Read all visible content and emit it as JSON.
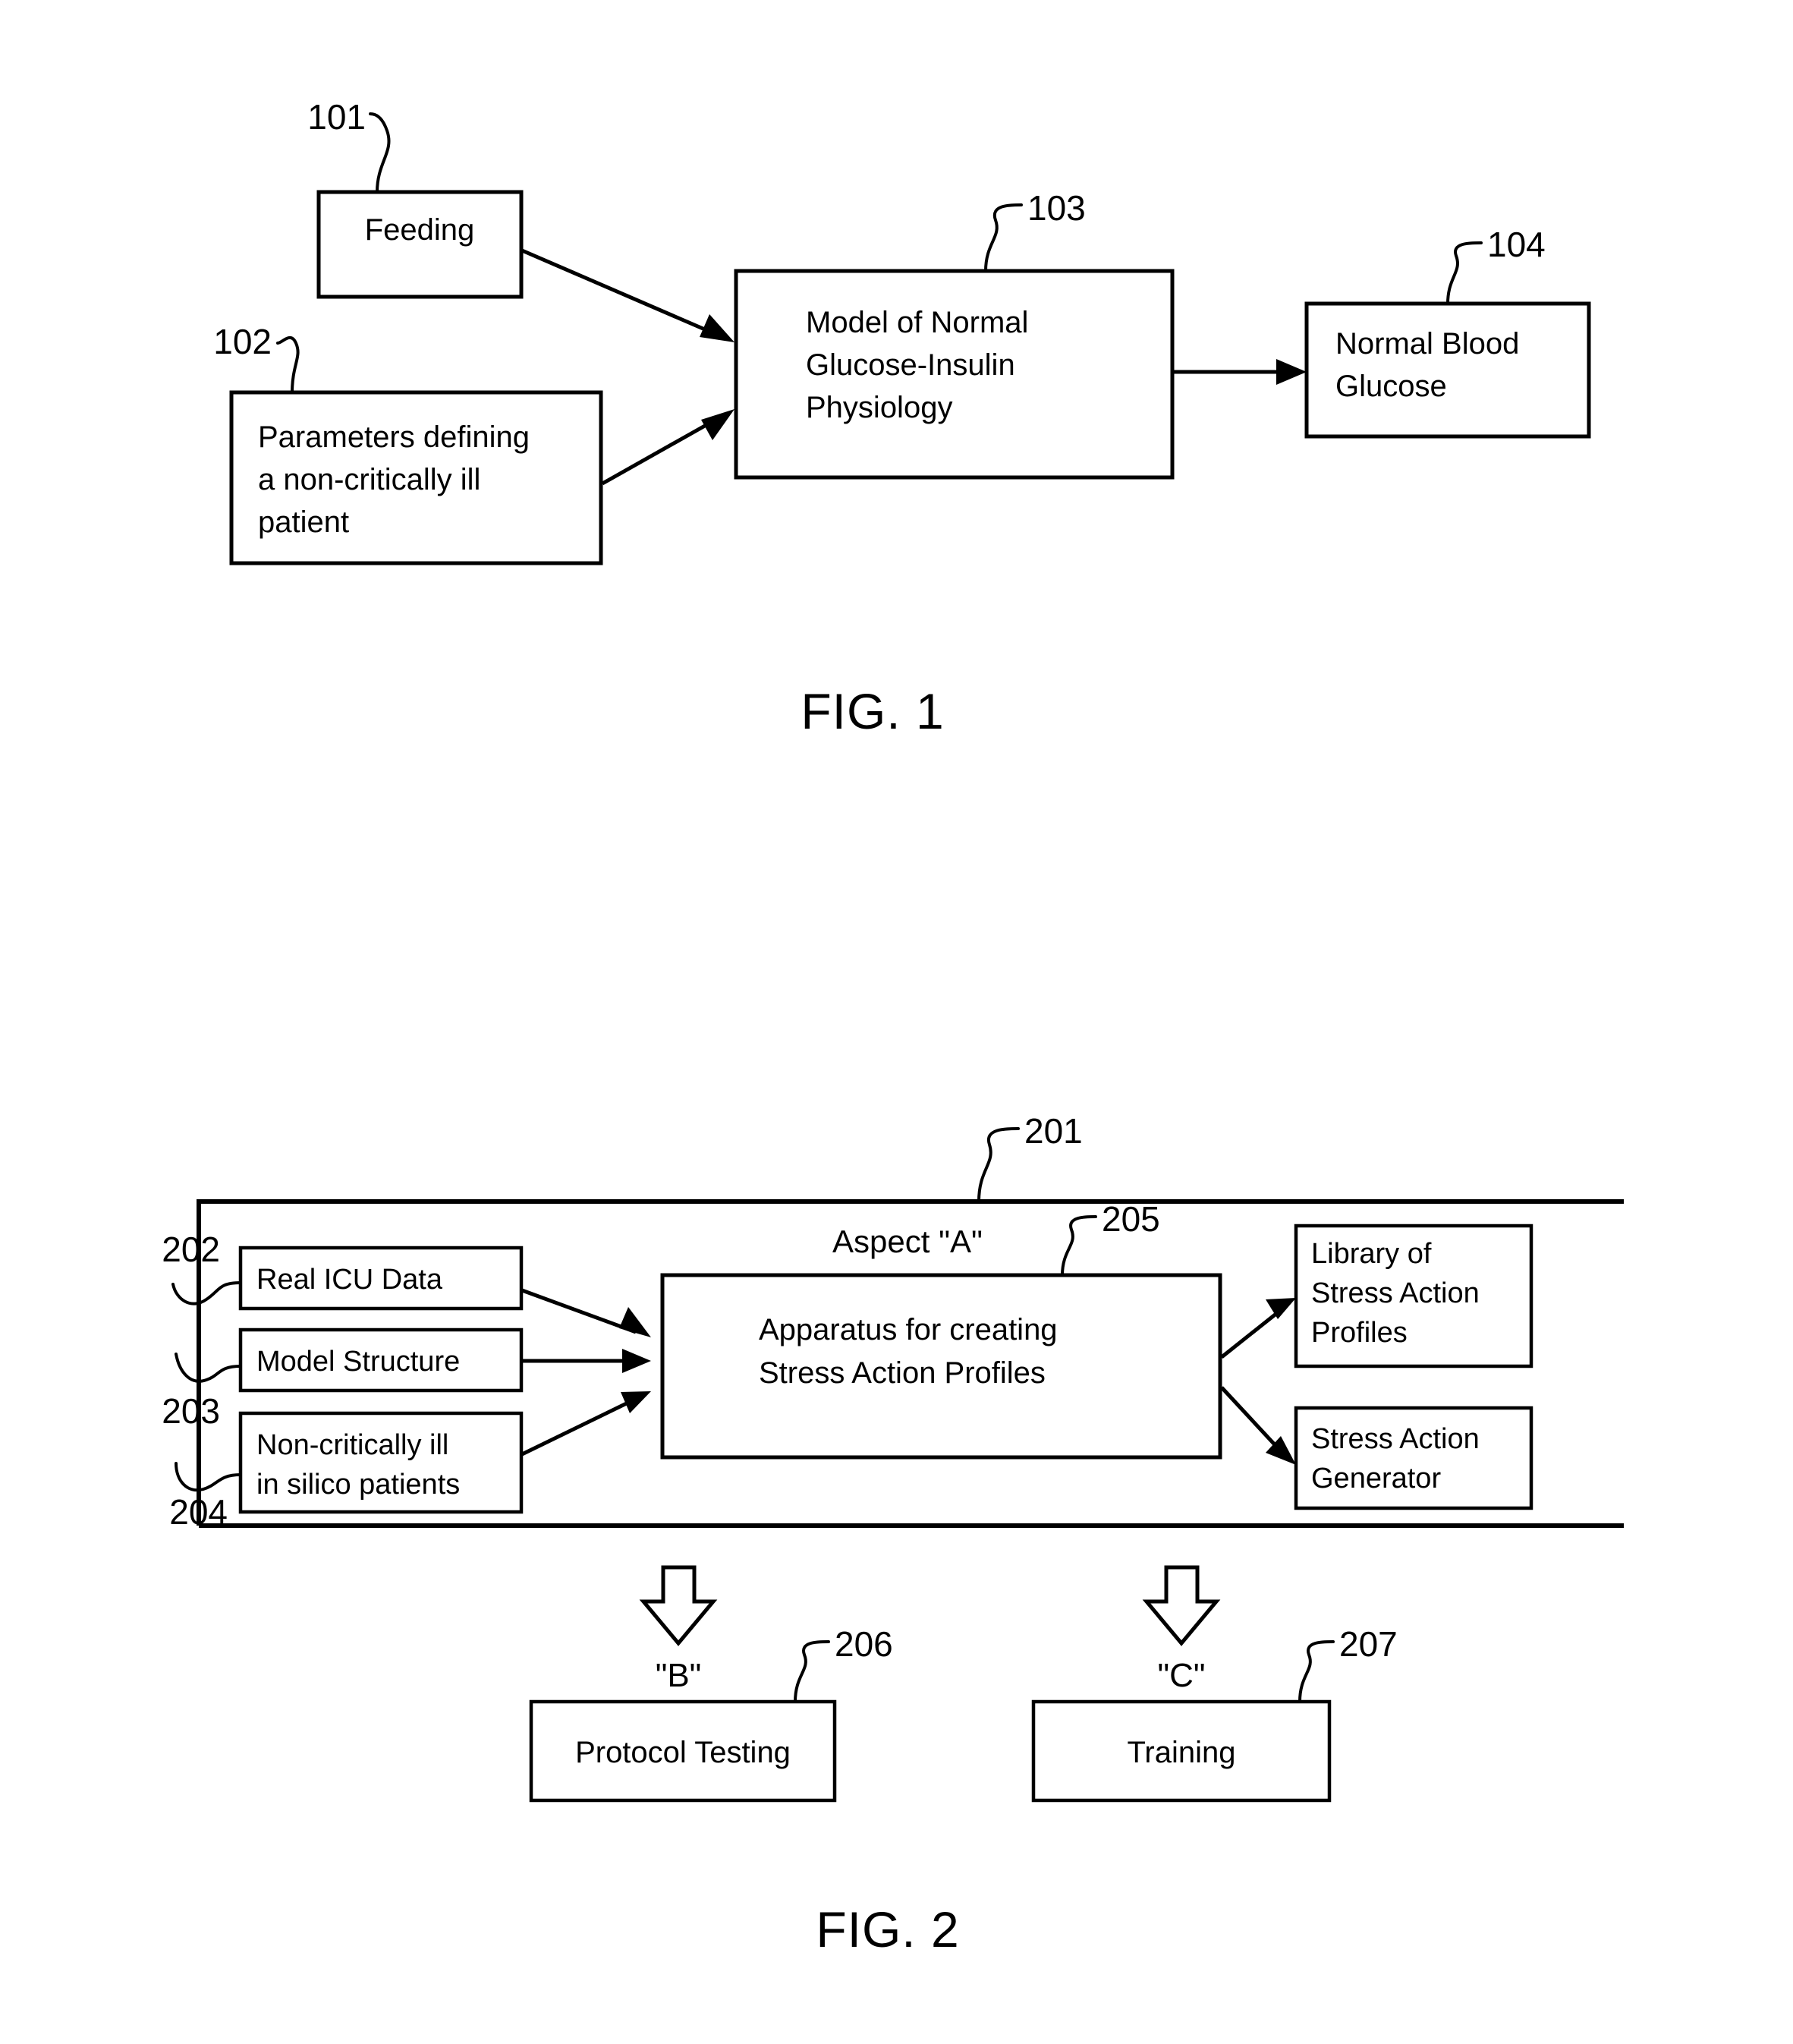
{
  "figures": [
    {
      "caption": "FIG. 1",
      "boxes": [
        {
          "ref": "101",
          "label": "Feeding",
          "lines": [
            "Feeding"
          ]
        },
        {
          "ref": "102",
          "label": "Parameters defining a non-critically ill patient",
          "lines": [
            "Parameters defining",
            "a non-critically ill",
            "patient"
          ]
        },
        {
          "ref": "103",
          "label": "Model of Normal Glucose-Insulin Physiology",
          "lines": [
            "Model of Normal",
            "Glucose-Insulin",
            "Physiology"
          ]
        },
        {
          "ref": "104",
          "label": "Normal Blood Glucose",
          "lines": [
            "Normal Blood",
            "Glucose"
          ]
        }
      ]
    },
    {
      "caption": "FIG. 2",
      "container": {
        "ref": "201",
        "label": "Aspect \"A\""
      },
      "boxes": [
        {
          "ref": "202",
          "label": "Real ICU Data",
          "lines": [
            "Real ICU Data"
          ]
        },
        {
          "ref": "203",
          "label": "Model Structure",
          "lines": [
            "Model Structure"
          ]
        },
        {
          "ref": "204",
          "label": "Non-critically ill in silico patients",
          "lines": [
            "Non-critically ill",
            "in silico patients"
          ]
        },
        {
          "ref": "205",
          "label": "Apparatus for creating Stress Action Profiles",
          "lines": [
            "Apparatus for creating",
            "Stress Action Profiles"
          ]
        },
        {
          "ref": "",
          "label": "Library of Stress Action Profiles",
          "lines": [
            "Library of",
            "Stress Action",
            "Profiles"
          ]
        },
        {
          "ref": "",
          "label": "Stress Action Generator",
          "lines": [
            "Stress Action",
            "Generator"
          ]
        },
        {
          "ref": "206",
          "label": "Protocol Testing",
          "lines": [
            "Protocol Testing"
          ]
        },
        {
          "ref": "207",
          "label": "Training",
          "lines": [
            "Training"
          ]
        }
      ],
      "branch_labels": [
        {
          "id": "B",
          "text": "\"B\""
        },
        {
          "id": "C",
          "text": "\"C\""
        }
      ]
    }
  ],
  "fig1": {
    "caption": "FIG. 1",
    "feeding": {
      "ref": "101",
      "line1": "Feeding"
    },
    "parameters": {
      "ref": "102",
      "line1": "Parameters defining",
      "line2": "a non-critically ill",
      "line3": "patient"
    },
    "model": {
      "ref": "103",
      "line1": "Model of Normal",
      "line2": "Glucose-Insulin",
      "line3": "Physiology"
    },
    "output": {
      "ref": "104",
      "line1": "Normal Blood",
      "line2": "Glucose"
    }
  },
  "fig2": {
    "caption": "FIG. 2",
    "container": {
      "ref": "201",
      "aspect_label": "Aspect \"A\""
    },
    "icu": {
      "ref": "202",
      "line1": "Real ICU Data"
    },
    "structure": {
      "ref": "203",
      "line1": "Model Structure"
    },
    "insilico": {
      "ref": "204",
      "line1": "Non-critically ill",
      "line2": "in silico patients"
    },
    "apparatus": {
      "ref": "205",
      "line1": "Apparatus for creating",
      "line2": "Stress Action Profiles"
    },
    "library": {
      "line1": "Library of",
      "line2": "Stress Action",
      "line3": "Profiles"
    },
    "generator": {
      "line1": "Stress Action",
      "line2": "Generator"
    },
    "branch_b": {
      "letter": "\"B\"",
      "ref": "206",
      "line1": "Protocol Testing"
    },
    "branch_c": {
      "letter": "\"C\"",
      "ref": "207",
      "line1": "Training"
    }
  },
  "colors": {
    "ink": "#000000",
    "paper": "#ffffff"
  }
}
